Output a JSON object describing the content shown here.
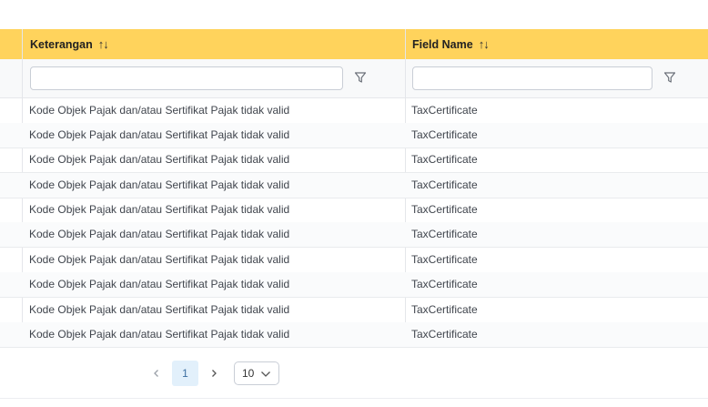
{
  "table": {
    "columns": [
      {
        "label": "Keterangan",
        "sort_glyph": "↑↓"
      },
      {
        "label": "Field Name",
        "sort_glyph": "↑↓"
      }
    ],
    "filters": [
      {
        "value": "",
        "placeholder": ""
      },
      {
        "value": "",
        "placeholder": ""
      }
    ],
    "rows": [
      {
        "keterangan": "Kode Objek Pajak dan/atau Sertifikat Pajak tidak valid",
        "field_name": "TaxCertificate"
      },
      {
        "keterangan": "Kode Objek Pajak dan/atau Sertifikat Pajak tidak valid",
        "field_name": "TaxCertificate"
      },
      {
        "keterangan": "Kode Objek Pajak dan/atau Sertifikat Pajak tidak valid",
        "field_name": "TaxCertificate"
      },
      {
        "keterangan": "Kode Objek Pajak dan/atau Sertifikat Pajak tidak valid",
        "field_name": "TaxCertificate"
      },
      {
        "keterangan": "Kode Objek Pajak dan/atau Sertifikat Pajak tidak valid",
        "field_name": "TaxCertificate"
      },
      {
        "keterangan": "Kode Objek Pajak dan/atau Sertifikat Pajak tidak valid",
        "field_name": "TaxCertificate"
      },
      {
        "keterangan": "Kode Objek Pajak dan/atau Sertifikat Pajak tidak valid",
        "field_name": "TaxCertificate"
      },
      {
        "keterangan": "Kode Objek Pajak dan/atau Sertifikat Pajak tidak valid",
        "field_name": "TaxCertificate"
      },
      {
        "keterangan": "Kode Objek Pajak dan/atau Sertifikat Pajak tidak valid",
        "field_name": "TaxCertificate"
      },
      {
        "keterangan": "Kode Objek Pajak dan/atau Sertifikat Pajak tidak valid",
        "field_name": "TaxCertificate"
      }
    ]
  },
  "pagination": {
    "prev_icon": "chevron-left-icon",
    "next_icon": "chevron-right-icon",
    "current_page": "1",
    "page_size": "10"
  },
  "colors": {
    "header_bg": "#ffd35c",
    "active_page_bg": "#e2f0fb"
  }
}
